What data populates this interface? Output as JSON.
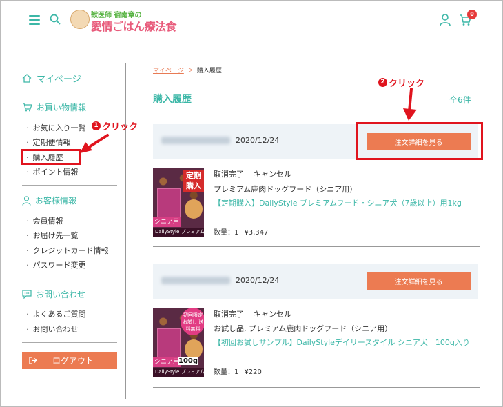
{
  "header": {
    "logo_small": "獣医師 宿南章の",
    "logo_big": "愛情ごはん療法食",
    "cart_count": "0"
  },
  "sidebar": {
    "mypage": "マイページ",
    "shopping": {
      "title": "お買い物情報",
      "items": [
        "お気に入り一覧",
        "定期便情報",
        "購入履歴",
        "ポイント情報"
      ]
    },
    "customer": {
      "title": "お客様情報",
      "items": [
        "会員情報",
        "お届け先一覧",
        "クレジットカード情報",
        "パスワード変更"
      ]
    },
    "contact": {
      "title": "お問い合わせ",
      "items": [
        "よくあるご質問",
        "お問い合わせ"
      ]
    },
    "logout": "ログアウト"
  },
  "breadcrumb": {
    "parent": "マイページ",
    "separator": "＞",
    "current": "購入履歴"
  },
  "page_title": "購入履歴",
  "total_count": "全6件",
  "orders": [
    {
      "date": "2020/12/24",
      "detail_button": "注文詳細を見る",
      "status": "取消完了",
      "status2": "キャンセル",
      "category": "プレミアム鹿肉ドッグフード（シニア用）",
      "product_name": "【定期購入】DailyStyle プレミアムフード・シニア犬（7歳以上）用1kg",
      "qty": "数量：1",
      "price": "¥3,347",
      "image_ribbon": "定期購入",
      "image_tag": "シニア用",
      "image_strip": "DailyStyle プレミアムフー"
    },
    {
      "date": "2020/12/24",
      "detail_button": "注文詳細を見る",
      "status": "取消完了",
      "status2": "キャンセル",
      "category": "お試し品, プレミアム鹿肉ドッグフード（シニア用）",
      "product_name": "【初回お試しサンプル】DailyStyleデイリースタイル シニア犬　100g入り",
      "qty": "数量：1",
      "price": "¥220",
      "image_circle": "初回限定 お試し 送料無料",
      "image_tag": "シニア用",
      "image_weight": "100g",
      "image_strip": "DailyStyle プレミアムフー"
    }
  ],
  "annotations": {
    "step1_num": "1",
    "step1_text": "クリック",
    "step2_num": "2",
    "step2_text": "クリック"
  },
  "colors": {
    "accent": "#3cb7a7",
    "button": "#ec7b52",
    "annotation": "#e0141e",
    "order_header_bg": "#eef3f7"
  },
  "icons": [
    "menu-icon",
    "search-icon",
    "user-icon",
    "cart-icon",
    "home-icon",
    "cart-small-icon",
    "person-icon",
    "chat-icon",
    "logout-icon"
  ]
}
